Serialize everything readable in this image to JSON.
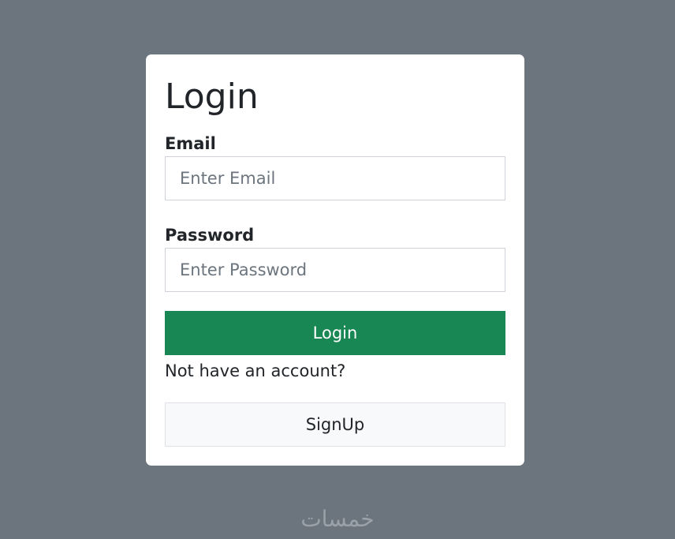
{
  "form": {
    "title": "Login",
    "email_label": "Email",
    "email_placeholder": "Enter Email",
    "password_label": "Password",
    "password_placeholder": "Enter Password",
    "login_button": "Login",
    "signup_prompt": "Not have an account?",
    "signup_button": "SignUp"
  },
  "watermark": "خمسات",
  "colors": {
    "page_background": "#6c757d",
    "card_background": "#ffffff",
    "login_button": "#198754",
    "signup_button": "#f8f9fa"
  }
}
